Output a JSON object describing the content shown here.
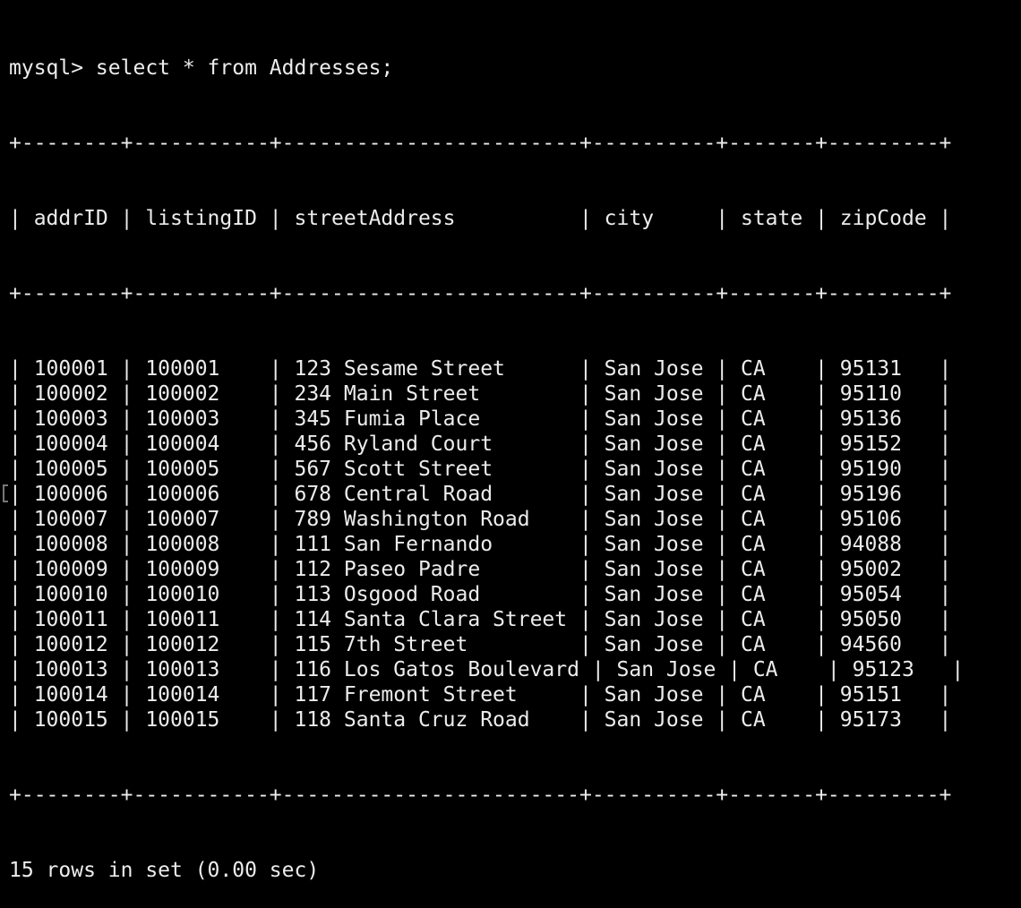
{
  "terminal": {
    "command_line": "mysql> select * from Addresses;",
    "border_line": "+--------+-----------+------------------------+----------+-------+---------+",
    "columns": [
      "addrID",
      "listingID",
      "streetAddress",
      "city",
      "state",
      "zipCode"
    ],
    "rows": [
      [
        "100001",
        "100001",
        "123 Sesame Street",
        "San Jose",
        "CA",
        "95131"
      ],
      [
        "100002",
        "100002",
        "234 Main Street",
        "San Jose",
        "CA",
        "95110"
      ],
      [
        "100003",
        "100003",
        "345 Fumia Place",
        "San Jose",
        "CA",
        "95136"
      ],
      [
        "100004",
        "100004",
        "456 Ryland Court",
        "San Jose",
        "CA",
        "95152"
      ],
      [
        "100005",
        "100005",
        "567 Scott Street",
        "San Jose",
        "CA",
        "95190"
      ],
      [
        "100006",
        "100006",
        "678 Central Road",
        "San Jose",
        "CA",
        "95196"
      ],
      [
        "100007",
        "100007",
        "789 Washington Road",
        "San Jose",
        "CA",
        "95106"
      ],
      [
        "100008",
        "100008",
        "111 San Fernando",
        "San Jose",
        "CA",
        "94088"
      ],
      [
        "100009",
        "100009",
        "112 Paseo Padre",
        "San Jose",
        "CA",
        "95002"
      ],
      [
        "100010",
        "100010",
        "113 Osgood Road",
        "San Jose",
        "CA",
        "95054"
      ],
      [
        "100011",
        "100011",
        "114 Santa Clara Street",
        "San Jose",
        "CA",
        "95050"
      ],
      [
        "100012",
        "100012",
        "115 7th Street",
        "San Jose",
        "CA",
        "94560"
      ],
      [
        "100013",
        "100013",
        "116 Los Gatos Boulevard",
        "San Jose",
        "CA",
        "95123"
      ],
      [
        "100014",
        "100014",
        "117 Fremont Street",
        "San Jose",
        "CA",
        "95151"
      ],
      [
        "100015",
        "100015",
        "118 Santa Cruz Road",
        "San Jose",
        "CA",
        "95173"
      ]
    ],
    "result_line": "15 rows in set (0.00 sec)"
  },
  "colors": {
    "background": "#000000",
    "text": "#ececec"
  }
}
